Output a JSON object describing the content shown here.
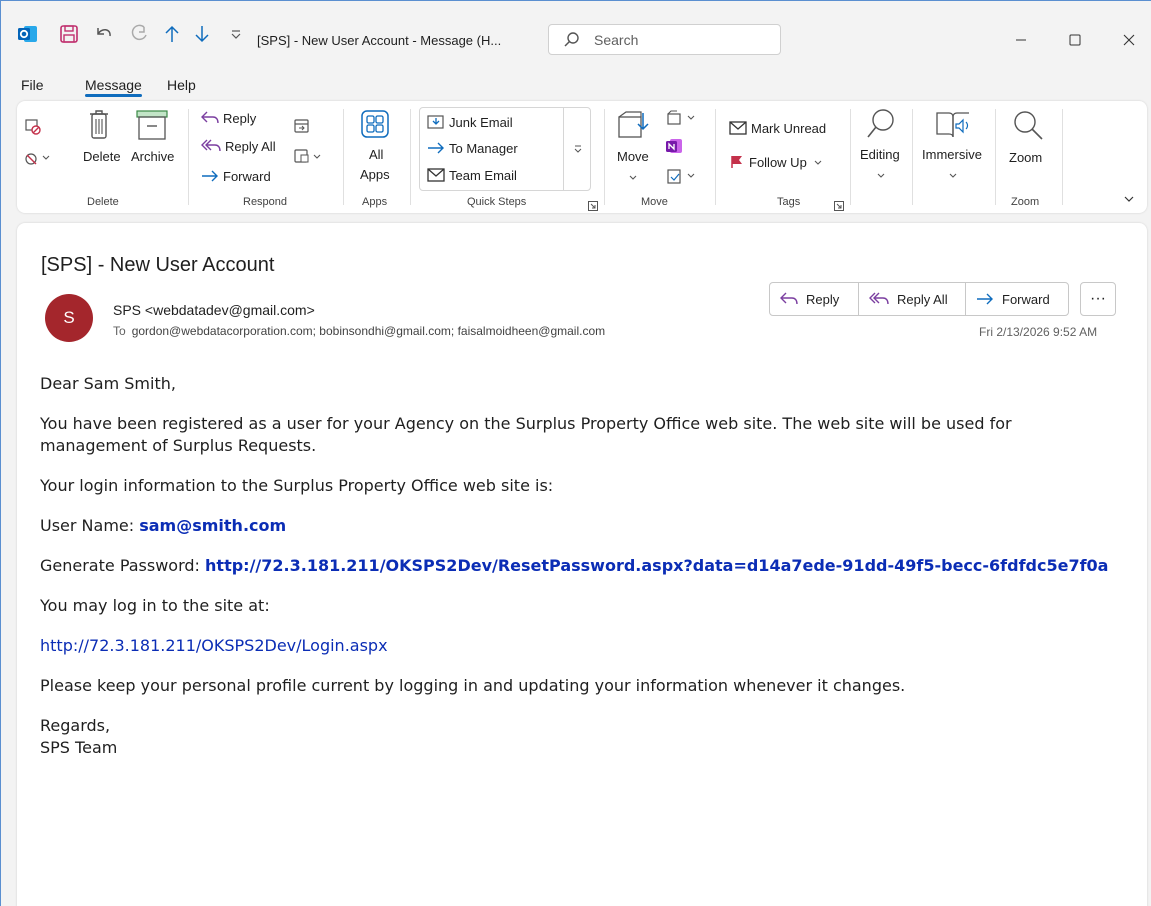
{
  "titlebar": {
    "title": "[SPS] - New User Account  -  Message (H...",
    "search_placeholder": "Search"
  },
  "menu": {
    "tabs": [
      {
        "label": "File"
      },
      {
        "label": "Message"
      },
      {
        "label": "Help"
      }
    ]
  },
  "ribbon": {
    "delete_group": {
      "label": "Delete",
      "delete": "Delete",
      "archive": "Archive"
    },
    "respond_group": {
      "label": "Respond",
      "reply": "Reply",
      "reply_all": "Reply All",
      "forward": "Forward"
    },
    "apps_group": {
      "label": "Apps",
      "all_apps_line1": "All",
      "all_apps_line2": "Apps"
    },
    "quicksteps_group": {
      "label": "Quick Steps",
      "items": [
        "Junk Email",
        "To Manager",
        "Team Email"
      ]
    },
    "move_group": {
      "label": "Move",
      "move": "Move"
    },
    "tags_group": {
      "label": "Tags",
      "mark_unread": "Mark Unread",
      "follow_up": "Follow Up"
    },
    "editing": "Editing",
    "immersive": "Immersive",
    "zoom_group": {
      "label": "Zoom",
      "zoom": "Zoom"
    }
  },
  "message": {
    "subject": "[SPS] - New User Account",
    "avatar_initial": "S",
    "sender": "SPS <webdatadev@gmail.com>",
    "to_label": "To",
    "recipients": "gordon@webdatacorporation.com; bobinsondhi@gmail.com; faisalmoidheen@gmail.com",
    "date": "Fri 2/13/2026 9:52 AM",
    "actions": {
      "reply": "Reply",
      "reply_all": "Reply All",
      "forward": "Forward",
      "more": "···"
    }
  },
  "body": {
    "greeting": "Dear Sam Smith,",
    "para1": "You have been registered as a user for your Agency on the Surplus Property Office web site. The web site will be used for management of Surplus Requests.",
    "para2": "Your login information to the Surplus Property Office web site is:",
    "username_label": "User Name: ",
    "username": "sam@smith.com",
    "password_label": "Generate Password: ",
    "password_link": "http://72.3.181.211/OKSPS2Dev/ResetPassword.aspx?data=d14a7ede-91dd-49f5-becc-6fdfdc5e7f0a",
    "login_prompt": "You may log in to the site at:",
    "login_link": "http://72.3.181.211/OKSPS2Dev/Login.aspx",
    "para3": "Please keep your personal profile current by logging in and updating your information whenever it changes.",
    "regards": "Regards,",
    "team": "SPS Team"
  }
}
